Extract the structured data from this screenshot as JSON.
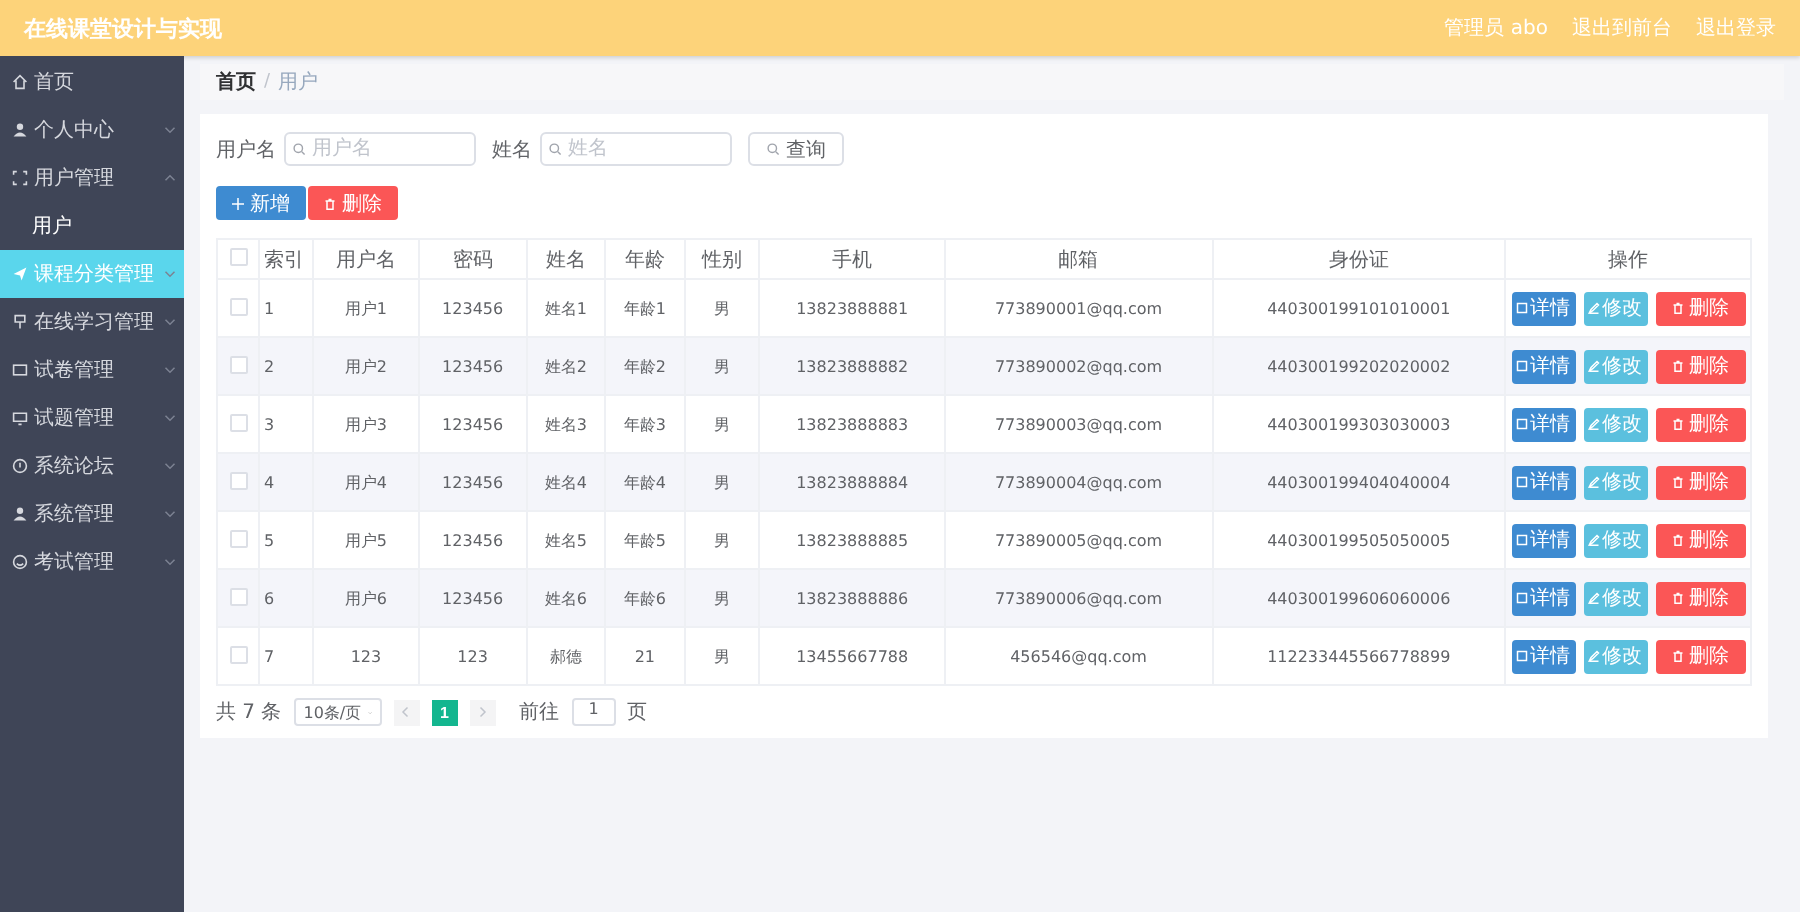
{
  "header": {
    "title": "在线课堂设计与实现",
    "links": [
      "管理员 abo",
      "退出到前台",
      "退出登录"
    ]
  },
  "sidebar": {
    "items": [
      {
        "label": "首页",
        "kind": "link",
        "selected": false
      },
      {
        "label": "个人中心",
        "kind": "menu",
        "selected": false,
        "expanded": false
      },
      {
        "label": "用户管理",
        "kind": "menu",
        "selected": false,
        "expanded": true,
        "children": [
          {
            "label": "用户",
            "selected": false
          }
        ]
      },
      {
        "label": "课程分类管理",
        "kind": "menu",
        "selected": true,
        "expanded": false
      },
      {
        "label": "在线学习管理",
        "kind": "menu",
        "selected": false,
        "expanded": false
      },
      {
        "label": "试卷管理",
        "kind": "menu",
        "selected": false,
        "expanded": false
      },
      {
        "label": "试题管理",
        "kind": "menu",
        "selected": false,
        "expanded": false
      },
      {
        "label": "系统论坛",
        "kind": "menu",
        "selected": false,
        "expanded": false
      },
      {
        "label": "系统管理",
        "kind": "menu",
        "selected": false,
        "expanded": false
      },
      {
        "label": "考试管理",
        "kind": "menu",
        "selected": false,
        "expanded": false
      }
    ]
  },
  "breadcrumb": {
    "separator": "/",
    "items": [
      {
        "label": "首页",
        "current": false
      },
      {
        "label": "用户",
        "current": true
      }
    ]
  },
  "search": {
    "fields": [
      {
        "label": "用户名",
        "placeholder": "用户名"
      },
      {
        "label": "姓名",
        "placeholder": "姓名"
      }
    ],
    "button": "查询"
  },
  "toolbar": [
    {
      "label": "新增",
      "kind": "add"
    },
    {
      "label": "删除",
      "kind": "delete"
    }
  ],
  "table": {
    "select_all_checked": false,
    "columns": [
      "索引",
      "用户名",
      "密码",
      "姓名",
      "年龄",
      "性别",
      "手机",
      "邮箱",
      "身份证",
      "操作"
    ],
    "rows": [
      {
        "checked": false,
        "cells": [
          "1",
          "用户1",
          "123456",
          "姓名1",
          "年龄1",
          "男",
          "13823888881",
          "773890001@qq.com",
          "440300199101010001"
        ],
        "actions": [
          {
            "label": "详情",
            "kind": "detail"
          },
          {
            "label": "修改",
            "kind": "edit"
          },
          {
            "label": "删除",
            "kind": "delete"
          }
        ]
      },
      {
        "checked": false,
        "cells": [
          "2",
          "用户2",
          "123456",
          "姓名2",
          "年龄2",
          "男",
          "13823888882",
          "773890002@qq.com",
          "440300199202020002"
        ],
        "actions": [
          {
            "label": "详情",
            "kind": "detail"
          },
          {
            "label": "修改",
            "kind": "edit"
          },
          {
            "label": "删除",
            "kind": "delete"
          }
        ]
      },
      {
        "checked": false,
        "cells": [
          "3",
          "用户3",
          "123456",
          "姓名3",
          "年龄3",
          "男",
          "13823888883",
          "773890003@qq.com",
          "440300199303030003"
        ],
        "actions": [
          {
            "label": "详情",
            "kind": "detail"
          },
          {
            "label": "修改",
            "kind": "edit"
          },
          {
            "label": "删除",
            "kind": "delete"
          }
        ]
      },
      {
        "checked": false,
        "cells": [
          "4",
          "用户4",
          "123456",
          "姓名4",
          "年龄4",
          "男",
          "13823888884",
          "773890004@qq.com",
          "440300199404040004"
        ],
        "actions": [
          {
            "label": "详情",
            "kind": "detail"
          },
          {
            "label": "修改",
            "kind": "edit"
          },
          {
            "label": "删除",
            "kind": "delete"
          }
        ]
      },
      {
        "checked": false,
        "cells": [
          "5",
          "用户5",
          "123456",
          "姓名5",
          "年龄5",
          "男",
          "13823888885",
          "773890005@qq.com",
          "440300199505050005"
        ],
        "actions": [
          {
            "label": "详情",
            "kind": "detail"
          },
          {
            "label": "修改",
            "kind": "edit"
          },
          {
            "label": "删除",
            "kind": "delete"
          }
        ]
      },
      {
        "checked": false,
        "cells": [
          "6",
          "用户6",
          "123456",
          "姓名6",
          "年龄6",
          "男",
          "13823888886",
          "773890006@qq.com",
          "440300199606060006"
        ],
        "actions": [
          {
            "label": "详情",
            "kind": "detail"
          },
          {
            "label": "修改",
            "kind": "edit"
          },
          {
            "label": "删除",
            "kind": "delete"
          }
        ]
      },
      {
        "checked": false,
        "cells": [
          "7",
          "123",
          "123",
          "郝德",
          "21",
          "男",
          "13455667788",
          "456546@qq.com",
          "112233445566778899"
        ],
        "actions": [
          {
            "label": "详情",
            "kind": "detail"
          },
          {
            "label": "修改",
            "kind": "edit"
          },
          {
            "label": "删除",
            "kind": "delete"
          }
        ]
      }
    ]
  },
  "pagination": {
    "total": "共 7 条",
    "page_size": "10条/页",
    "pages": [
      {
        "label": "1",
        "selected": true
      }
    ],
    "goto_label": "前往",
    "goto_value": "1",
    "goto_suffix": "页"
  }
}
